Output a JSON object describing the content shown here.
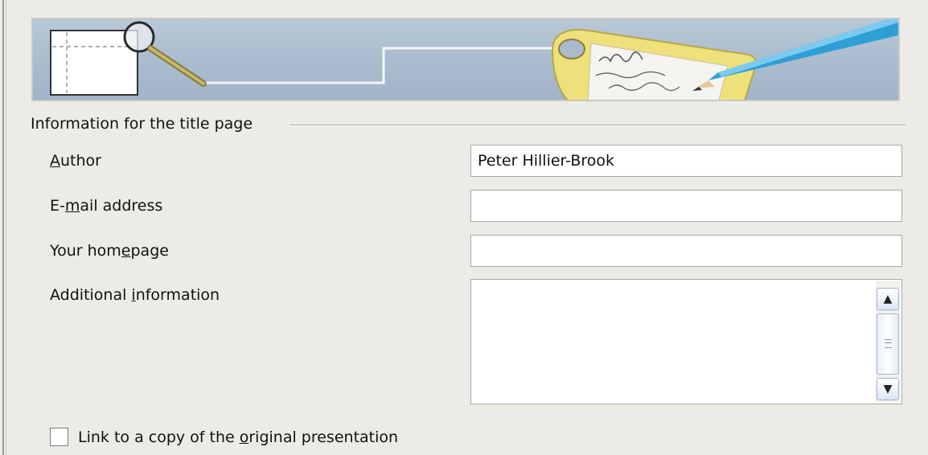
{
  "group": {
    "title": "Information for the title page"
  },
  "fields": {
    "author": {
      "label_pre": "",
      "label_key": "A",
      "label_post": "uthor",
      "value": "Peter Hillier-Brook"
    },
    "email": {
      "label_pre": "E-",
      "label_key": "m",
      "label_post": "ail address",
      "value": ""
    },
    "homepage": {
      "label_pre": "Your hom",
      "label_key": "e",
      "label_post": "page",
      "value": ""
    },
    "additional": {
      "label_pre": "Additional ",
      "label_key": "i",
      "label_post": "nformation",
      "value": ""
    }
  },
  "link_checkbox": {
    "label_pre": "Link to a copy of the ",
    "label_key": "o",
    "label_post": "riginal presentation",
    "checked": false
  },
  "icons": {
    "banner": "wizard-banner-image",
    "scroll_up": "chevron-up-icon",
    "scroll_down": "chevron-down-icon"
  },
  "colors": {
    "dialog_bg": "#ecebe6",
    "banner_blue": "#a9bbcd",
    "tag_yellow": "#eee07a",
    "pencil_blue": "#2f9fd6"
  }
}
